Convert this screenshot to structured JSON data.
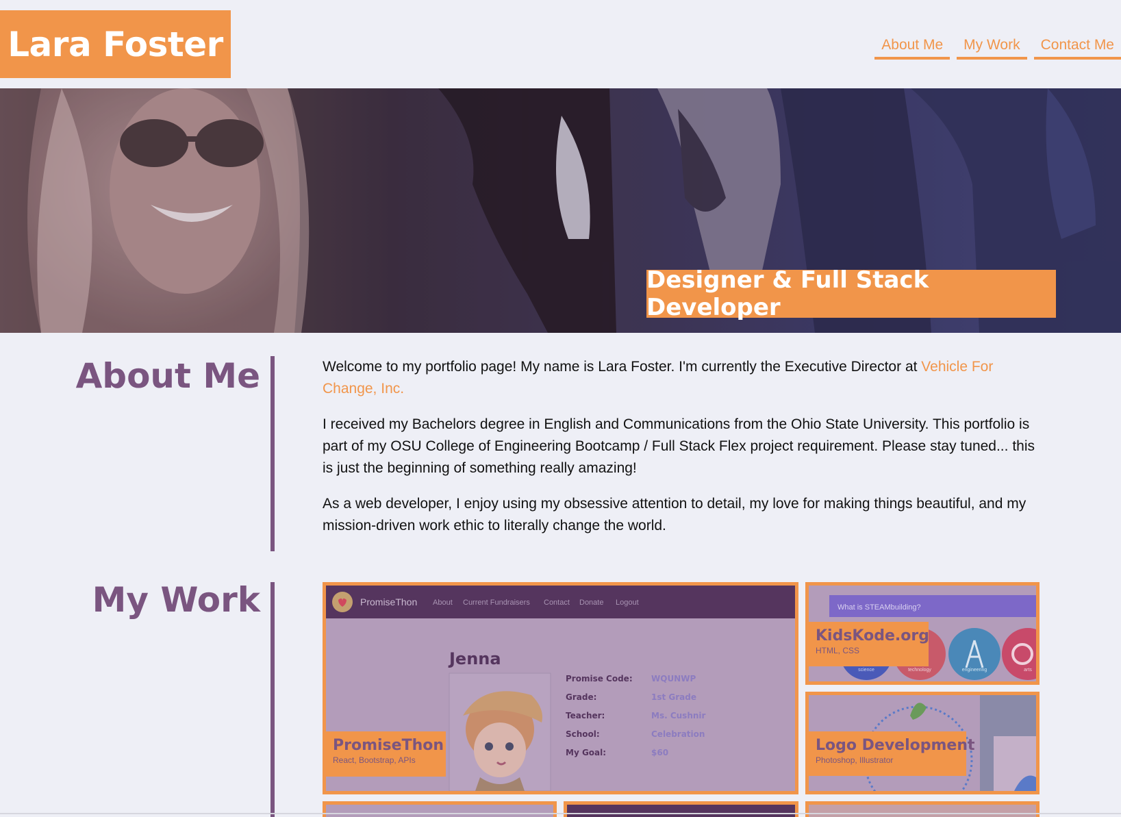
{
  "header": {
    "brand": "Lara Foster",
    "nav": [
      "About Me",
      "My Work",
      "Contact Me"
    ]
  },
  "hero": {
    "title": "Designer & Full Stack Developer"
  },
  "about": {
    "heading": "About Me",
    "p1_text": "Welcome to my portfolio page! My name is Lara Foster. I'm currently the Executive Director at ",
    "p1_link": "Vehicle For Change, Inc.",
    "p2": "I received my Bachelors degree in English and Communications from the Ohio State University. This portfolio is part of my OSU College of Engineering Bootcamp / Full Stack Flex project requirement. Please stay tuned... this is just the beginning of something really amazing!",
    "p3": "As a web developer, I enjoy using my obsessive attention to detail, my love for making things beautiful, and my mission-driven work ethic to literally change the world."
  },
  "work": {
    "heading": "My Work",
    "projects": [
      {
        "title": "PromiseThon",
        "tech": "React, Bootstrap, APIs",
        "screenshot": {
          "app_name": "PromiseThon",
          "menu": [
            "About",
            "Current Fundraisers",
            "Contact",
            "Donate",
            "Logout"
          ],
          "student": "Jenna",
          "fields": [
            {
              "label": "Promise Code:",
              "value": "WQUNWP"
            },
            {
              "label": "Grade:",
              "value": "1st Grade"
            },
            {
              "label": "Teacher:",
              "value": "Ms. Cushnir"
            },
            {
              "label": "School:",
              "value": "Celebration"
            },
            {
              "label": "My Goal:",
              "value": "$60"
            }
          ]
        }
      },
      {
        "title": "KidsKode.org",
        "tech": "HTML, CSS",
        "screenshot": {
          "search_text": "What is STEAMbuilding?",
          "circle_labels": [
            "science",
            "technology",
            "engineering",
            "arts"
          ]
        }
      },
      {
        "title": "Logo Development",
        "tech": "Photoshop, Illustrator"
      }
    ]
  },
  "colors": {
    "accent": "#f1954a",
    "purple": "#7a5580",
    "background": "#eeeff6"
  }
}
